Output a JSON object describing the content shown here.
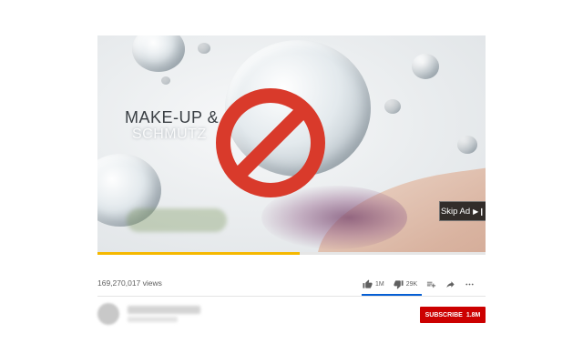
{
  "player": {
    "overlay_text_line1": "MAKE-UP &",
    "overlay_text_line2": "SCHMUTZ",
    "skip_button_label": "Skip Ad",
    "skip_icon": "skip-next-icon",
    "progress_fraction": 0.52,
    "progress_color": "#f5b800",
    "block_icon": "no-entry-icon",
    "block_icon_color": "#d93a2b"
  },
  "video": {
    "title": "",
    "views": "169,270,017 views"
  },
  "actions": {
    "like_count": "1M",
    "dislike_count": "29K",
    "icons": [
      "thumbs-up-icon",
      "thumbs-down-icon",
      "add-to-playlist-icon",
      "share-icon",
      "more-icon"
    ],
    "accent_color": "#065fd4"
  },
  "channel": {
    "subscribe_label": "SUBSCRIBE",
    "subscriber_count": "1.8M",
    "subscribe_color": "#cc0000"
  }
}
